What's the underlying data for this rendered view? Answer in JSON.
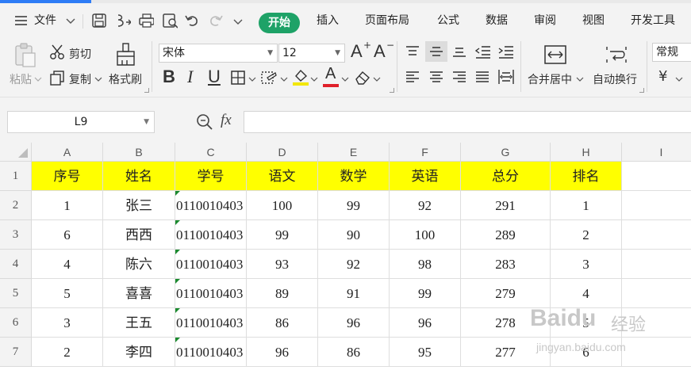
{
  "menu": {
    "file": "文件",
    "tabs": [
      "开始",
      "插入",
      "页面布局",
      "公式",
      "数据",
      "审阅",
      "视图",
      "开发工具"
    ]
  },
  "ribbon": {
    "paste": "粘贴",
    "cut": "剪切",
    "copy": "复制",
    "format_painter": "格式刷",
    "font_name": "宋体",
    "font_size": "12",
    "merge_center": "合并居中",
    "wrap_text": "自动换行",
    "number_format": "常规",
    "bold": "B",
    "italic": "I",
    "underline": "U",
    "grow_font": "A",
    "shrink_font": "A",
    "font_color_letter": "A",
    "currency": "¥"
  },
  "formula_bar": {
    "name_box": "L9",
    "fx": "fx",
    "formula": ""
  },
  "sheet": {
    "columns": [
      "A",
      "B",
      "C",
      "D",
      "E",
      "F",
      "G",
      "H",
      "I"
    ],
    "rows": [
      "1",
      "2",
      "3",
      "4",
      "5",
      "6",
      "7"
    ],
    "cells": [
      [
        "序号",
        "姓名",
        "学号",
        "语文",
        "数学",
        "英语",
        "总分",
        "排名"
      ],
      [
        "1",
        "张三",
        "0110010403",
        "100",
        "99",
        "92",
        "291",
        "1"
      ],
      [
        "6",
        "西西",
        "0110010403",
        "99",
        "90",
        "100",
        "289",
        "2"
      ],
      [
        "4",
        "陈六",
        "0110010403",
        "93",
        "92",
        "98",
        "283",
        "3"
      ],
      [
        "5",
        "喜喜",
        "0110010403",
        "89",
        "91",
        "99",
        "279",
        "4"
      ],
      [
        "3",
        "王五",
        "0110010403",
        "86",
        "96",
        "96",
        "278",
        "5"
      ],
      [
        "2",
        "李四",
        "0110010403",
        "96",
        "86",
        "95",
        "277",
        "6"
      ]
    ]
  },
  "watermark": {
    "brand": "Baidu",
    "brand_cn": "经验",
    "url": "jingyan.baidu.com"
  },
  "colors": {
    "active_tab": "#1ea267",
    "header_fill": "#ffff00",
    "ribbon_bg": "#f3f3f3"
  }
}
